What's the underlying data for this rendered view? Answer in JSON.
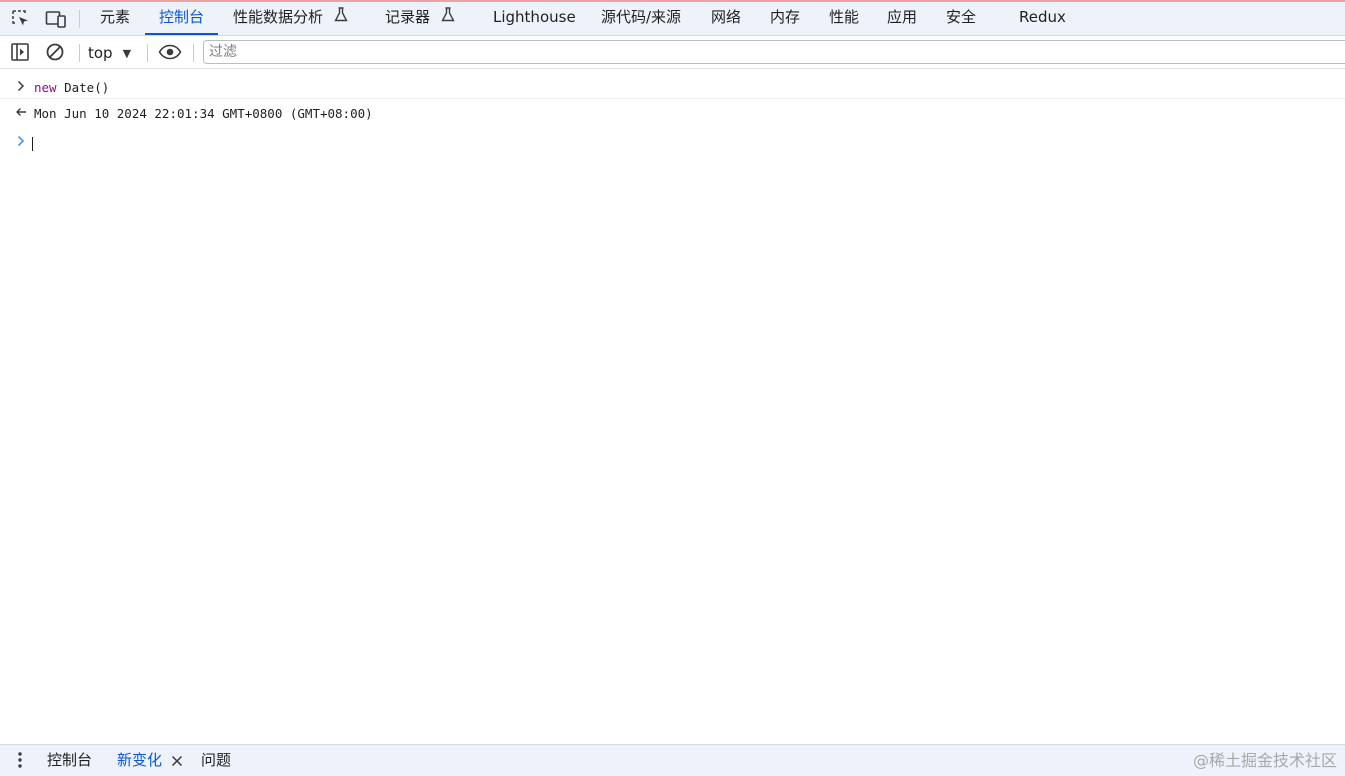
{
  "tabbar": {
    "icons": [
      "inspect-element-icon",
      "device-toolbar-icon"
    ],
    "tabs": [
      {
        "label": "元素"
      },
      {
        "label": "控制台",
        "active": true
      },
      {
        "label": "性能数据分析",
        "icon": "flask-icon"
      },
      {
        "label": "记录器",
        "icon": "flask-icon"
      },
      {
        "label": "Lighthouse"
      },
      {
        "label": "源代码/来源"
      },
      {
        "label": "网络"
      },
      {
        "label": "内存"
      },
      {
        "label": "性能"
      },
      {
        "label": "应用"
      },
      {
        "label": "安全"
      },
      {
        "label": "Redux"
      }
    ]
  },
  "console_toolbar": {
    "icons": [
      "sidebar-toggle-icon",
      "clear-console-icon",
      "eye-icon"
    ],
    "context": "top",
    "filter_placeholder": "过滤"
  },
  "console": {
    "input": {
      "keyword": "new",
      "rest": " Date()"
    },
    "output": "Mon Jun 10 2024 22:01:34 GMT+0800 (GMT+08:00)"
  },
  "drawer": {
    "tabs": [
      {
        "label": "控制台"
      },
      {
        "label": "新变化",
        "active": true,
        "closable": true
      },
      {
        "label": "问题"
      }
    ],
    "watermark": "@稀土掘金技术社区"
  },
  "colors": {
    "accent": "#0b57d0",
    "toolbar_bg": "#eef3fb",
    "keyword": "#881280",
    "prompt": "#3a8ee6"
  }
}
